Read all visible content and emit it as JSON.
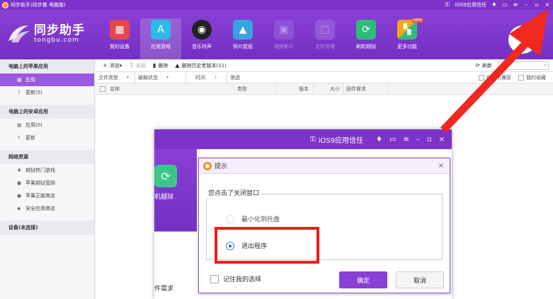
{
  "titlebar": {
    "title": "同步助手(同步推 电脑版)",
    "trust_label": "iOS9应用信任",
    "controls": [
      "minimize",
      "maximize",
      "close"
    ]
  },
  "brand": {
    "name": "同步助手",
    "sub": "tongbu.com"
  },
  "nav": [
    {
      "label": "我的设备",
      "icon": "store-icon",
      "color": "#e5464f"
    },
    {
      "label": "应用游戏",
      "icon": "app-store-icon",
      "color": "#2eb9e8"
    },
    {
      "label": "音乐铃声",
      "icon": "music-disc-icon",
      "color": "#222222"
    },
    {
      "label": "照片壁纸",
      "icon": "photo-icon",
      "color": "#37a3e0"
    },
    {
      "label": "视频影片",
      "icon": "film-icon",
      "color": "#9d6ee0"
    },
    {
      "label": "文件管理",
      "icon": "folder-icon",
      "color": "#a67de6"
    },
    {
      "label": "刷机越狱",
      "icon": "refresh-icon",
      "color": "#2fbb7a"
    },
    {
      "label": "更多功能",
      "icon": "grid-icon",
      "color": "#f5a51b",
      "badge": "NEW"
    }
  ],
  "sidebar": {
    "sections": [
      {
        "title": "电脑上的苹果应用",
        "items": [
          {
            "label": "应用",
            "active": true
          },
          {
            "label": "更新(5)"
          }
        ]
      },
      {
        "title": "电脑上的安卓应用",
        "items": [
          {
            "label": "应用(0)"
          },
          {
            "label": "更新"
          }
        ]
      },
      {
        "title": "网络资源",
        "items": [
          {
            "label": "越狱热门游戏"
          },
          {
            "label": "苹果越狱宽频"
          },
          {
            "label": "苹果正版商店"
          },
          {
            "label": "安全应用商店"
          }
        ]
      },
      {
        "title": "设备(未连接)",
        "items": []
      }
    ]
  },
  "toolbar": {
    "add": "添加",
    "install": "安装",
    "delete": "删除",
    "delete_old": "删除历史老版本(11)",
    "refresh": "刷新"
  },
  "filters": {
    "file_type": "文件类型",
    "crack_status": "破解状态",
    "time": "时间",
    "filter": "筛选",
    "show_compatible": "仅显示兼容",
    "my_favorites": "我的收藏"
  },
  "table": {
    "columns": [
      "名称",
      "类型",
      "版本",
      "大小",
      "固件需求"
    ]
  },
  "trust_dialog": {
    "title": "iOS9应用信任",
    "left_label": "机越狱",
    "left_need": "件需求"
  },
  "prompt": {
    "title": "提示",
    "group_title": "您点击了关闭窗口",
    "option_minimize": "最小化到托盘",
    "option_exit": "退出程序",
    "remember": "记住我的选择",
    "ok": "确定",
    "cancel": "取消"
  }
}
